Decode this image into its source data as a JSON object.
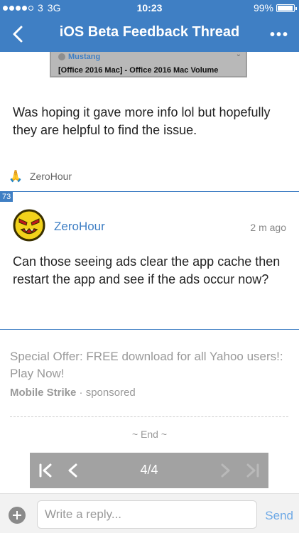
{
  "status_bar": {
    "carrier": "3",
    "network": "3G",
    "time": "10:23",
    "battery": "99%"
  },
  "nav": {
    "title": "iOS Beta Feedback Thread",
    "more_label": "•••"
  },
  "quoted_image": {
    "user": "Mustang",
    "title": "[Office 2016 Mac] - Office 2016 Mac Volume"
  },
  "previous_post": {
    "text": "Was hoping it gave more info lol but hopefully they are helpful to find the issue.",
    "liked_by": "ZeroHour"
  },
  "post": {
    "number": "73",
    "author": "ZeroHour",
    "time_ago": "2 m ago",
    "text": "Can those seeing ads clear the app cache then restart the app and see if the ads occur now?"
  },
  "ad": {
    "text": "Special Offer: FREE download for all Yahoo users!: Play Now!",
    "brand": "Mobile Strike",
    "separator": " · ",
    "label": "sponsored"
  },
  "end_label": "~ End ~",
  "pager": {
    "current": "4/4"
  },
  "reply": {
    "placeholder": "Write a reply...",
    "send_label": "Send"
  },
  "colors": {
    "accent": "#3f7fc4",
    "pager_bg": "#a2a2a2"
  }
}
